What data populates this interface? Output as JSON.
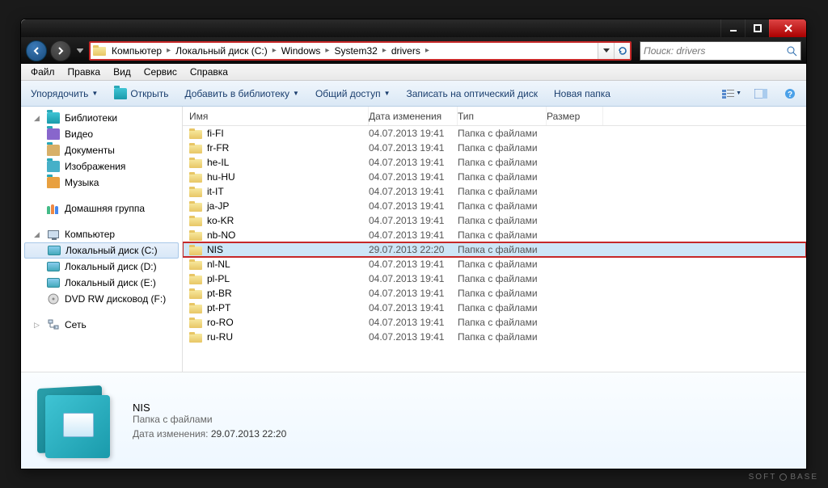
{
  "search": {
    "placeholder": "Поиск: drivers"
  },
  "breadcrumb": [
    "Компьютер",
    "Локальный диск (C:)",
    "Windows",
    "System32",
    "drivers"
  ],
  "menus": [
    "Файл",
    "Правка",
    "Вид",
    "Сервис",
    "Справка"
  ],
  "toolbar": {
    "organize": "Упорядочить",
    "open": "Открыть",
    "addlib": "Добавить в библиотеку",
    "share": "Общий доступ",
    "burn": "Записать на оптический диск",
    "newfolder": "Новая папка"
  },
  "tree": {
    "libraries": {
      "label": "Библиотеки",
      "items": [
        "Видео",
        "Документы",
        "Изображения",
        "Музыка"
      ]
    },
    "homegroup": "Домашняя группа",
    "computer": {
      "label": "Компьютер",
      "items": [
        "Локальный диск (C:)",
        "Локальный диск (D:)",
        "Локальный диск (E:)",
        "DVD RW дисковод (F:)"
      ],
      "selected": 0
    },
    "network": "Сеть"
  },
  "columns": {
    "name": "Имя",
    "date": "Дата изменения",
    "type": "Тип",
    "size": "Размер"
  },
  "folder_type": "Папка с файлами",
  "files": [
    {
      "name": "fi-FI",
      "date": "04.07.2013 19:41"
    },
    {
      "name": "fr-FR",
      "date": "04.07.2013 19:41"
    },
    {
      "name": "he-IL",
      "date": "04.07.2013 19:41"
    },
    {
      "name": "hu-HU",
      "date": "04.07.2013 19:41"
    },
    {
      "name": "it-IT",
      "date": "04.07.2013 19:41"
    },
    {
      "name": "ja-JP",
      "date": "04.07.2013 19:41"
    },
    {
      "name": "ko-KR",
      "date": "04.07.2013 19:41"
    },
    {
      "name": "nb-NO",
      "date": "04.07.2013 19:41"
    },
    {
      "name": "NIS",
      "date": "29.07.2013 22:20",
      "selected": true,
      "highlighted": true
    },
    {
      "name": "nl-NL",
      "date": "04.07.2013 19:41"
    },
    {
      "name": "pl-PL",
      "date": "04.07.2013 19:41"
    },
    {
      "name": "pt-BR",
      "date": "04.07.2013 19:41"
    },
    {
      "name": "pt-PT",
      "date": "04.07.2013 19:41"
    },
    {
      "name": "ro-RO",
      "date": "04.07.2013 19:41"
    },
    {
      "name": "ru-RU",
      "date": "04.07.2013 19:41"
    }
  ],
  "details": {
    "name": "NIS",
    "type": "Папка с файлами",
    "date_label": "Дата изменения:",
    "date": "29.07.2013 22:20"
  },
  "watermark": {
    "left": "SOFT",
    "right": "BASE"
  }
}
